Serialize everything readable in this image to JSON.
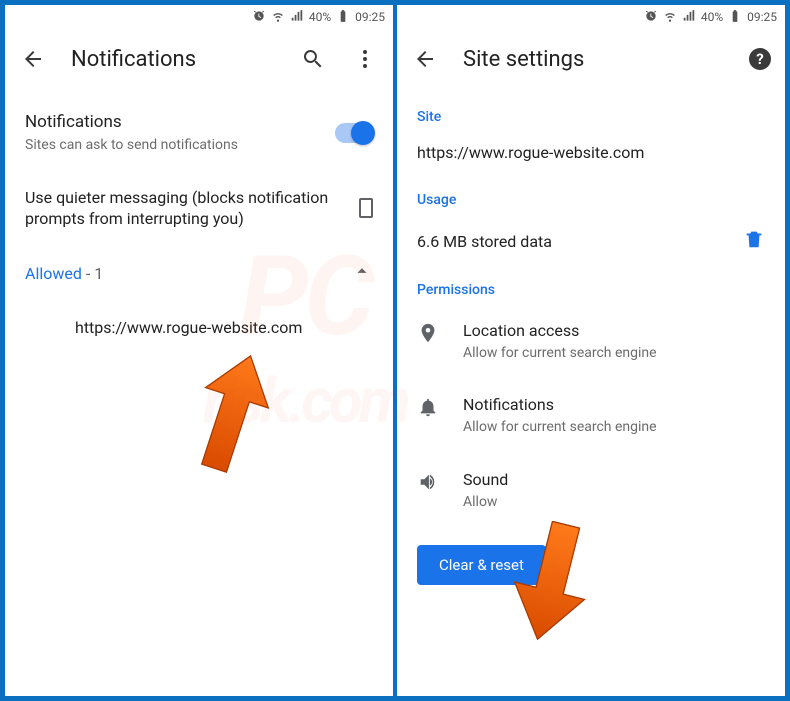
{
  "status": {
    "battery_pct": "40%",
    "time": "09:25"
  },
  "left": {
    "title": "Notifications",
    "notif_label": "Notifications",
    "notif_sub": "Sites can ask to send notifications",
    "quieter_label": "Use quieter messaging (blocks notification prompts from interrupting you)",
    "allowed_label": "Allowed",
    "allowed_count": "- 1",
    "site": "https://www.rogue-website.com"
  },
  "right": {
    "title": "Site settings",
    "section_site": "Site",
    "site_url": "https://www.rogue-website.com",
    "section_usage": "Usage",
    "usage_text": "6.6 MB stored data",
    "section_permissions": "Permissions",
    "perm_location_title": "Location access",
    "perm_location_sub": "Allow for current search engine",
    "perm_notif_title": "Notifications",
    "perm_notif_sub": "Allow for current search engine",
    "perm_sound_title": "Sound",
    "perm_sound_sub": "Allow",
    "clear_btn": "Clear & reset"
  }
}
